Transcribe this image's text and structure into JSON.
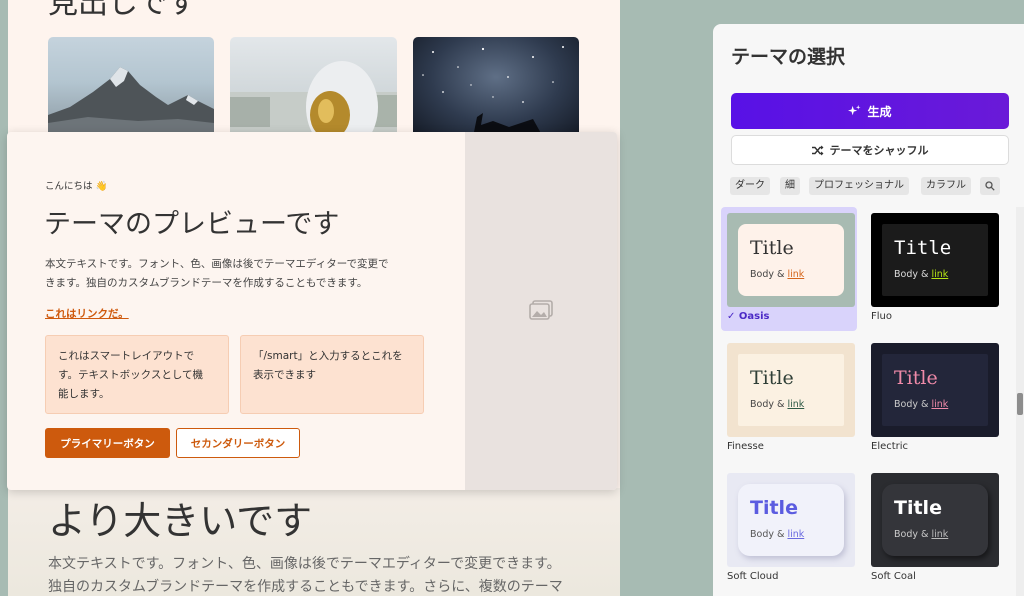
{
  "slide": {
    "top_title": "見出しです",
    "photos": [
      {
        "icon": "mountain-photo"
      },
      {
        "icon": "astronaut-photo"
      },
      {
        "icon": "night-sky-photo"
      }
    ],
    "bottom_heading": "より大きいです",
    "bottom_body_1": "本文テキストです。フォント、色、画像は後でテーマエディターで変更できます。",
    "bottom_body_2": "独自のカスタムブランドテーマを作成することもできます。さらに、複数のテーマ"
  },
  "preview": {
    "greeting": "こんにちは 👋",
    "title": "テーマのプレビューです",
    "body_1": "本文テキストです。フォント、色、画像は後でテーマエディターで変更で",
    "body_2": "きます。独自のカスタムブランドテーマを作成することもできます。",
    "link": "これはリンクだ。",
    "smart_box_1": [
      "これはスマートレイアウトで",
      "す。テキストボックスとして機",
      "能します。"
    ],
    "smart_box_2": [
      "「/smart」と入力するとこれを",
      "表示できます"
    ],
    "primary_button": "プライマリーボタン",
    "secondary_button": "セカンダリーボタン",
    "image_icon": "image-placeholder-icon"
  },
  "panel": {
    "title": "テーマの選択",
    "generate_label": "生成",
    "shuffle_label": "テーマをシャッフル",
    "filters": [
      "ダーク",
      "細",
      "プロフェッショナル",
      "カラフル"
    ],
    "search_icon": "search-icon",
    "sample_title": "Title",
    "sample_body": "Body & ",
    "sample_link": "link",
    "selected_mark": "✓",
    "themes": [
      {
        "name": "Oasis",
        "selected": true
      },
      {
        "name": "Fluo"
      },
      {
        "name": "Finesse"
      },
      {
        "name": "Electric"
      },
      {
        "name": "Soft Cloud"
      },
      {
        "name": "Soft Coal"
      }
    ]
  },
  "colors": {
    "accent": "#5811e6",
    "brand_orange": "#cd5a0d",
    "selected_tile": "#d9d3fb"
  }
}
